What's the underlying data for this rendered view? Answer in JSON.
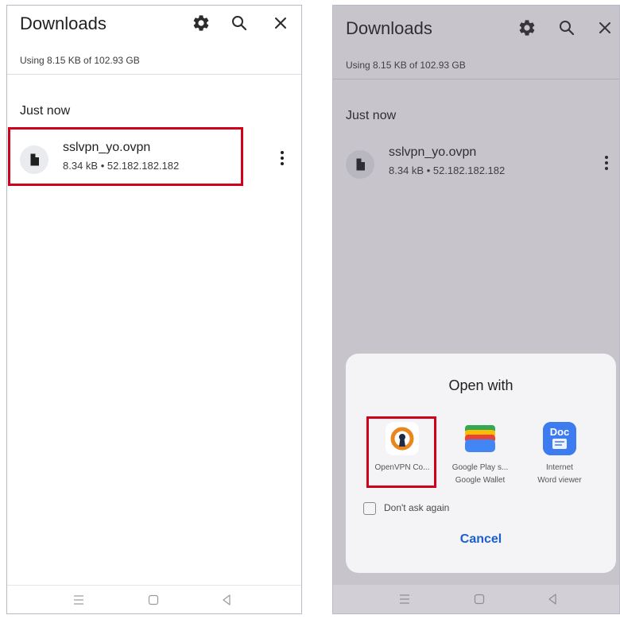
{
  "left_screen": {
    "title": "Downloads",
    "storage_text": "Using 8.15 KB of 102.93 GB",
    "section_label": "Just now",
    "file": {
      "name": "sslvpn_yo.ovpn",
      "meta": "8.34 kB • 52.182.182.182"
    }
  },
  "right_screen": {
    "title": "Downloads",
    "storage_text": "Using 8.15 KB of 102.93 GB",
    "section_label": "Just now",
    "file": {
      "name": "sslvpn_yo.ovpn",
      "meta": "8.34 kB • 52.182.182.182"
    },
    "dialog": {
      "title": "Open with",
      "apps": [
        {
          "label": "OpenVPN Co...",
          "sublabel": "",
          "icon": "openvpn-icon"
        },
        {
          "label": "Google Play s...",
          "sublabel": "Google Wallet",
          "icon": "google-wallet-icon"
        },
        {
          "label": "Internet",
          "sublabel": "Word viewer",
          "icon": "doc-icon",
          "icon_text": "Doc"
        }
      ],
      "dont_ask_label": "Don't ask again",
      "dont_ask_checked": false,
      "cancel_label": "Cancel"
    }
  },
  "icons": {
    "settings": "gear-icon",
    "search": "search-icon",
    "close": "close-icon",
    "file": "file-icon",
    "more": "more-vert-icon",
    "nav_recents": "nav-recents-icon",
    "nav_home": "nav-home-icon",
    "nav_back": "nav-back-icon"
  },
  "colors": {
    "highlight": "#d0021b",
    "accent_blue": "#1a5fd0",
    "openvpn_orange": "#e8871e",
    "doc_blue": "#3d7bf0"
  }
}
